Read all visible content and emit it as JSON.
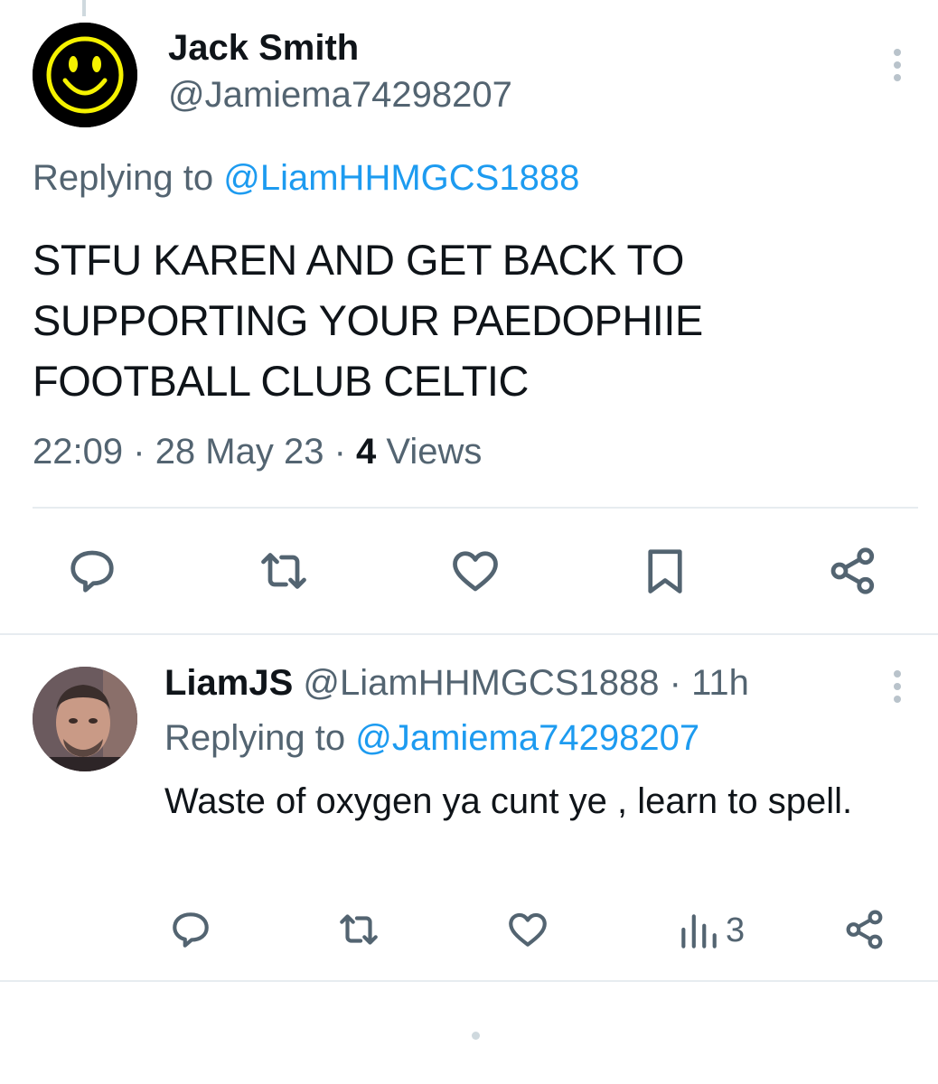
{
  "main_tweet": {
    "display_name": "Jack Smith",
    "handle": "@Jamiema74298207",
    "replying_prefix": "Replying to",
    "replying_to": "@LiamHHMGCS1888",
    "text": "STFU KAREN AND GET BACK TO SUPPORTING YOUR PAEDOPHIIE FOOTBALL CLUB CELTIC",
    "time": "22:09",
    "separator": "·",
    "date": "28 May 23",
    "views_count": "4",
    "views_label": "Views"
  },
  "reply_tweet": {
    "display_name": "LiamJS",
    "handle": "@LiamHHMGCS1888",
    "separator": "·",
    "age": "11h",
    "replying_prefix": "Replying to",
    "replying_to": "@Jamiema74298207",
    "text": "Waste of oxygen ya cunt ye , learn to spell.",
    "views": "3"
  },
  "icons": {
    "main_actions": [
      "reply-icon",
      "retweet-icon",
      "like-icon",
      "bookmark-icon",
      "share-icon"
    ],
    "reply_actions": [
      "reply-icon",
      "retweet-icon",
      "like-icon",
      "views-icon",
      "share-icon"
    ]
  },
  "colors": {
    "text": "#0f1419",
    "secondary": "#536471",
    "link": "#1d9bf0",
    "divider": "#e7ecf0",
    "avatar_smiley": "#f5f200"
  }
}
